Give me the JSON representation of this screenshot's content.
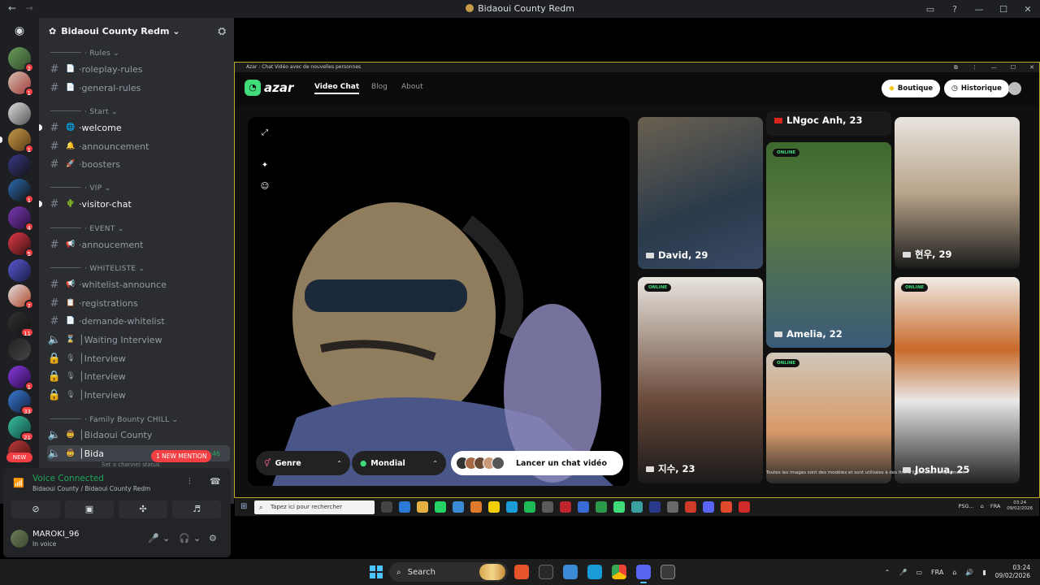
{
  "window": {
    "title": "Bidaoui County Redm",
    "back_icon": "arrow-left-icon",
    "forward_icon": "arrow-right-icon"
  },
  "guilds": {
    "badges": [
      "2",
      "1",
      "1",
      "1",
      "4",
      "5",
      "7",
      "11",
      "1",
      "33",
      "21"
    ],
    "new_label": "NEW"
  },
  "server": {
    "name": "Bidaoui County Redm",
    "categories": [
      {
        "name": "Rules",
        "channels": [
          {
            "name": "roleplay-rules",
            "emoji": "📄"
          },
          {
            "name": "general-rules",
            "emoji": "📄"
          }
        ]
      },
      {
        "name": "Start",
        "channels": [
          {
            "name": "welcome",
            "emoji": "🌐"
          },
          {
            "name": "announcement",
            "emoji": "🔔"
          },
          {
            "name": "boosters",
            "emoji": "🚀"
          }
        ]
      },
      {
        "name": "VIP",
        "channels": [
          {
            "name": "visitor-chat",
            "emoji": "🌵"
          }
        ]
      },
      {
        "name": "EVENT",
        "channels": [
          {
            "name": "annoucement",
            "emoji": "📢"
          }
        ]
      },
      {
        "name": "WHITELISTE",
        "channels": [
          {
            "name": "whitelist-announce",
            "emoji": "📢"
          },
          {
            "name": "registrations",
            "emoji": "📋"
          },
          {
            "name": "demande-whitelist",
            "emoji": "📄"
          },
          {
            "name": "Waiting Interview",
            "emoji": "⌛"
          },
          {
            "name": "Interview",
            "emoji": "🎙"
          },
          {
            "name": "Interview",
            "emoji": "🎙"
          },
          {
            "name": "Interview",
            "emoji": "🎙"
          }
        ]
      },
      {
        "name": "Family Bounty CHILL",
        "channels": [
          {
            "name": "Bidaoui County",
            "emoji": "🤠"
          },
          {
            "name": "Bida",
            "emoji": "🤠",
            "timer": "5:57:46"
          }
        ]
      }
    ],
    "mention_pill": "1 NEW MENTION",
    "set_status": "Set a channel status"
  },
  "voice": {
    "title": "Voice Connected",
    "subtitle": "Bidaoui County / Bidaoui County Redm"
  },
  "user": {
    "name": "MAROKI_96",
    "status": "In voice"
  },
  "azar": {
    "tab_title": "Azar : Chat Vidéo avec de nouvelles personnes",
    "logo": "azar",
    "nav": [
      "Video Chat",
      "Blog",
      "About"
    ],
    "boutique": "Boutique",
    "historique": "Historique",
    "genre": "Genre",
    "mondial": "Mondial",
    "start_chat": "Lancer un chat vidéo",
    "online": "ONLINE",
    "profiles": [
      {
        "name": "David, 29"
      },
      {
        "name": "LNgoc Anh, 23"
      },
      {
        "name": "Amelia, 22"
      },
      {
        "name": "현우, 29"
      },
      {
        "name": "지수, 23"
      },
      {
        "name": "Joshua, 25"
      }
    ],
    "disclaimer": "Toutes les images sont des modèles et sont utilisées à des fins d'illustration uniquement."
  },
  "inner_taskbar": {
    "search": "Tapez ici pour rechercher",
    "tray_label": "PSG...",
    "lang": "FRA",
    "time": "03:24",
    "date": "09/02/2026"
  },
  "taskbar": {
    "search": "Search",
    "lang": "FRA",
    "time": "03:24",
    "date": "09/02/2026"
  }
}
